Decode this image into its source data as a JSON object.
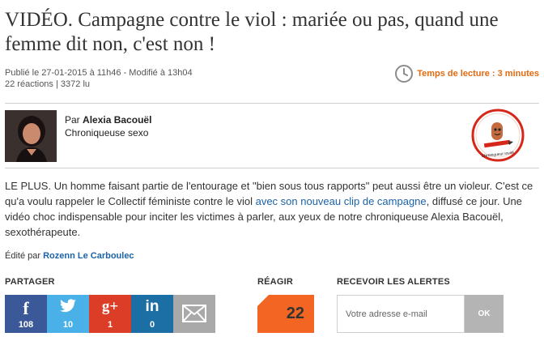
{
  "article": {
    "title": "VIDÉO. Campagne contre le viol : mariée ou pas, quand une femme dit non, c'est non !",
    "published": "Publié le 27-01-2015 à 11h46 - Modifié à 13h04",
    "reactions": "22 réactions",
    "reads": "3372 lu",
    "reading_time": "Temps de lecture : 3 minutes"
  },
  "author": {
    "prefix": "Par",
    "name": "Alexia Bacouël",
    "role": "Chroniqueuse sexo",
    "badge_text": "Chroniqueur invité"
  },
  "lead": {
    "part1": "LE PLUS. Un homme faisant partie de l'entourage et \"bien sous tous rapports\" peut aussi être un violeur. C'est ce qu'a voulu rappeler le Collectif féministe contre le viol ",
    "link": "avec son nouveau clip de campagne",
    "part2": ", diffusé ce jour. Une vidéo choc indispensable pour inciter les victimes à parler, aux yeux de notre chroniqueuse Alexia Bacouël, sexothérapeute."
  },
  "edited": {
    "prefix": "Édité par",
    "editor": "Rozenn Le Carboulec"
  },
  "share": {
    "label": "PARTAGER",
    "buttons": [
      {
        "icon": "f",
        "count": "108"
      },
      {
        "icon": "t",
        "count": "10"
      },
      {
        "icon": "g+",
        "count": "1"
      },
      {
        "icon": "in",
        "count": "0"
      }
    ]
  },
  "react": {
    "label": "RÉAGIR",
    "count": "22"
  },
  "alerts": {
    "label": "RECEVOIR LES ALERTES",
    "placeholder": "Votre adresse e-mail",
    "ok": "OK"
  },
  "colors": {
    "accent_orange": "#f26522",
    "facebook": "#3b5998",
    "twitter": "#4ab1e8",
    "googleplus": "#dc3d27",
    "linkedin": "#1b6fa5"
  }
}
